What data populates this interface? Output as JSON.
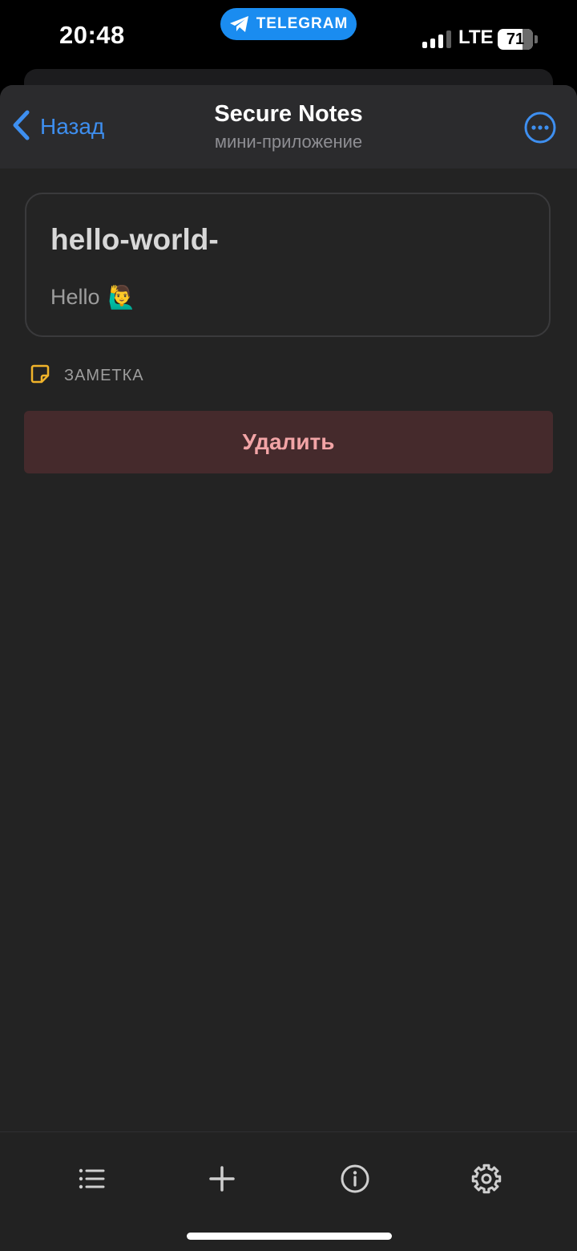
{
  "status_bar": {
    "time": "20:48",
    "app_pill": "TELEGRAM",
    "network": "LTE",
    "battery_level": "71",
    "battery_fraction": 0.71,
    "signal_bars": 3,
    "signal_total": 4
  },
  "header": {
    "back_label": "Назад",
    "title": "Secure Notes",
    "subtitle": "мини-приложение"
  },
  "note": {
    "title": "hello-world-",
    "body": "Hello",
    "body_emoji": "🙋‍♂️",
    "type_label": "ЗАМЕТКА"
  },
  "actions": {
    "delete_label": "Удалить"
  },
  "tabbar": {
    "items": [
      {
        "icon": "list-icon"
      },
      {
        "icon": "plus-icon"
      },
      {
        "icon": "info-icon"
      },
      {
        "icon": "gear-icon"
      }
    ]
  },
  "colors": {
    "accent": "#3e8ff0",
    "telegram_blue": "#1a8cf0",
    "background": "#232323",
    "header": "#2b2b2d",
    "danger_bg": "#452a2c",
    "danger_text": "#f2a4a6",
    "note_icon": "#f0b32a"
  }
}
